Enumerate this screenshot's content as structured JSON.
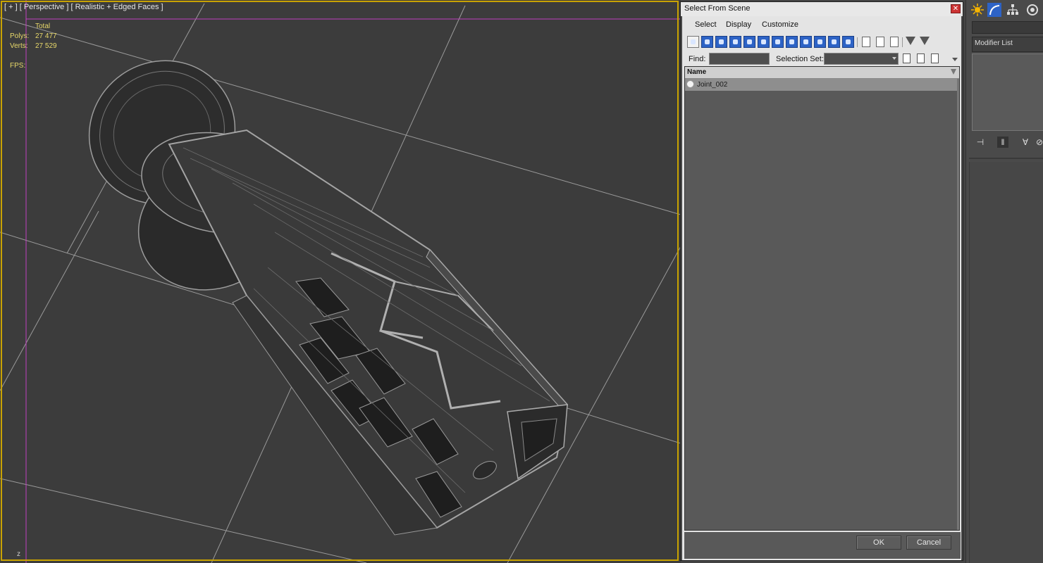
{
  "viewport": {
    "label": "[ + ] [ Perspective ] [ Realistic + Edged Faces ]",
    "stats": {
      "total_label": "Total",
      "polys_label": "Polys:",
      "polys_value": "27 477",
      "verts_label": "Verts:",
      "verts_value": "27 529",
      "fps_label": "FPS:"
    },
    "axis_label": "z",
    "frame_color": "#c9a300",
    "safe_frame_color": "#c040c0"
  },
  "dialog": {
    "title": "Select From Scene",
    "close_glyph": "✕",
    "menu": [
      "Select",
      "Display",
      "Customize"
    ],
    "find_label": "Find:",
    "find_value": "",
    "selection_set_label": "Selection Set:",
    "selection_set_value": "",
    "list_header": "Name",
    "rows": [
      {
        "name": "Joint_002",
        "icon": "sphere-icon"
      }
    ],
    "ok_label": "OK",
    "cancel_label": "Cancel"
  },
  "command_panel": {
    "modifier_list_label": "Modifier List",
    "tabs": [
      "create-icon",
      "modify-icon",
      "hierarchy-icon",
      "motion-icon"
    ]
  }
}
